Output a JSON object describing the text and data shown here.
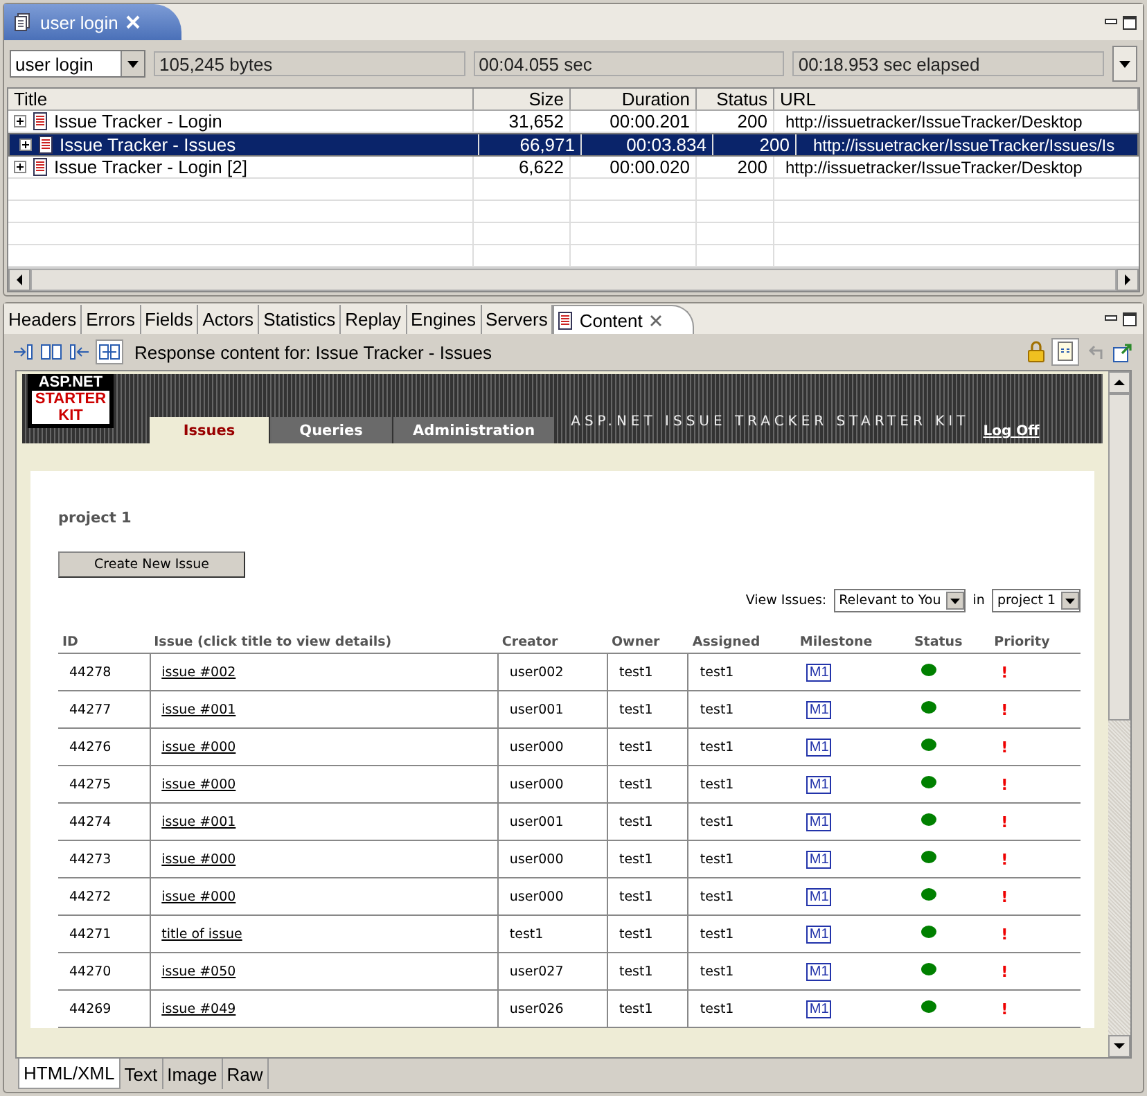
{
  "editor_tab": {
    "title": "user login",
    "selected": true
  },
  "summary": {
    "session": "user login",
    "fields": [
      "105,245 bytes",
      "00:04.055 sec",
      "00:18.953 sec elapsed"
    ]
  },
  "requests": {
    "columns": [
      "Title",
      "Size",
      "Duration",
      "Status",
      "URL"
    ],
    "rows": [
      {
        "title": "Issue Tracker - Login",
        "size": "31,652",
        "duration": "00:00.201",
        "status": "200",
        "url": "http://issuetracker/IssueTracker/Desktop",
        "selected": false
      },
      {
        "title": "Issue Tracker - Issues",
        "size": "66,971",
        "duration": "00:03.834",
        "status": "200",
        "url": "http://issuetracker/IssueTracker/Issues/Is",
        "selected": true
      },
      {
        "title": "Issue Tracker - Login [2]",
        "size": "6,622",
        "duration": "00:00.020",
        "status": "200",
        "url": "http://issuetracker/IssueTracker/Desktop",
        "selected": false
      }
    ]
  },
  "view_tabs": [
    {
      "label": "Headers",
      "selected": false
    },
    {
      "label": "Errors",
      "selected": false
    },
    {
      "label": "Fields",
      "selected": false
    },
    {
      "label": "Actors",
      "selected": false
    },
    {
      "label": "Statistics",
      "selected": false
    },
    {
      "label": "Replay",
      "selected": false
    },
    {
      "label": "Engines",
      "selected": false
    },
    {
      "label": "Servers",
      "selected": false
    },
    {
      "label": "Content",
      "selected": true
    }
  ],
  "content_caption": "Response content for: Issue Tracker - Issues",
  "web_page": {
    "logo": [
      "ASP.NET",
      "STARTER",
      "KIT"
    ],
    "nav_tabs": [
      {
        "label": "Issues",
        "selected": true
      },
      {
        "label": "Queries",
        "selected": false
      },
      {
        "label": "Administration",
        "selected": false
      }
    ],
    "banner": "ASP.NET ISSUE TRACKER STARTER KIT",
    "log_off": "Log Off",
    "project": "project 1",
    "create_button": "Create New Issue",
    "view_label": "View Issues:",
    "filter": "Relevant to You",
    "in_label": "in",
    "project_select": "project 1",
    "columns": [
      "ID",
      "Issue (click title to view details)",
      "Creator",
      "Owner",
      "Assigned",
      "Milestone",
      "Status",
      "Priority"
    ],
    "rows": [
      {
        "id": "44278",
        "title": "issue #002",
        "creator": "user002",
        "owner": "test1",
        "assigned": "test1",
        "milestone": "M1",
        "color": "#008000",
        "priority": "!"
      },
      {
        "id": "44277",
        "title": "issue #001",
        "creator": "user001",
        "owner": "test1",
        "assigned": "test1",
        "milestone": "M1",
        "color": "#008000",
        "priority": "!"
      },
      {
        "id": "44276",
        "title": "issue #000",
        "creator": "user000",
        "owner": "test1",
        "assigned": "test1",
        "milestone": "M1",
        "color": "#008000",
        "priority": "!"
      },
      {
        "id": "44275",
        "title": "issue #000",
        "creator": "user000",
        "owner": "test1",
        "assigned": "test1",
        "milestone": "M1",
        "color": "#008000",
        "priority": "!"
      },
      {
        "id": "44274",
        "title": "issue #001",
        "creator": "user001",
        "owner": "test1",
        "assigned": "test1",
        "milestone": "M1",
        "color": "#008000",
        "priority": "!"
      },
      {
        "id": "44273",
        "title": "issue #000",
        "creator": "user000",
        "owner": "test1",
        "assigned": "test1",
        "milestone": "M1",
        "color": "#008000",
        "priority": "!"
      },
      {
        "id": "44272",
        "title": "issue #000",
        "creator": "user000",
        "owner": "test1",
        "assigned": "test1",
        "milestone": "M1",
        "color": "#008000",
        "priority": "!"
      },
      {
        "id": "44271",
        "title": "title of issue",
        "creator": "test1",
        "owner": "test1",
        "assigned": "test1",
        "milestone": "M1",
        "color": "#008000",
        "priority": "!"
      },
      {
        "id": "44270",
        "title": "issue #050",
        "creator": "user027",
        "owner": "test1",
        "assigned": "test1",
        "milestone": "M1",
        "color": "#008000",
        "priority": "!"
      },
      {
        "id": "44269",
        "title": "issue #049",
        "creator": "user026",
        "owner": "test1",
        "assigned": "test1",
        "milestone": "M1",
        "color": "#008000",
        "priority": "!"
      }
    ]
  },
  "format_tabs": [
    {
      "label": "HTML/XML",
      "selected": true
    },
    {
      "label": "Text",
      "selected": false
    },
    {
      "label": "Image",
      "selected": false
    },
    {
      "label": "Raw",
      "selected": false
    }
  ]
}
